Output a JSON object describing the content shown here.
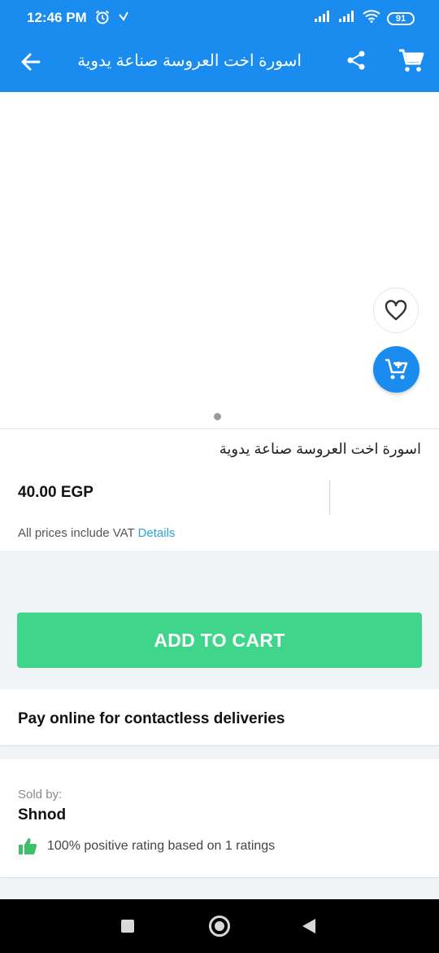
{
  "status_bar": {
    "time": "12:46 PM",
    "battery": "91",
    "icons": [
      "alarm-icon",
      "nfc-icon",
      "signal-icon",
      "signal-icon",
      "wifi-icon",
      "battery-icon"
    ]
  },
  "toolbar": {
    "title": "اسورة اخت العروسة صناعة يدوية",
    "back_icon": "arrow-left-icon",
    "share_icon": "share-icon",
    "cart_icon": "cart-icon"
  },
  "product": {
    "title": "اسورة اخت العروسة صناعة يدوية",
    "price": "40.00 EGP",
    "vat_text": "All prices include VAT",
    "vat_link": "Details",
    "image_page_count": 1
  },
  "actions": {
    "add_to_cart": "ADD TO CART"
  },
  "delivery": {
    "pay_online": "Pay online for contactless deliveries"
  },
  "seller": {
    "label": "Sold by:",
    "name": "Shnod",
    "rating_text": "100% positive rating based on 1 ratings"
  },
  "colors": {
    "primary": "#1a8cf0",
    "add_to_cart": "#3fd68c",
    "link": "#2ba3dc",
    "thumb": "#3fbf6a"
  }
}
